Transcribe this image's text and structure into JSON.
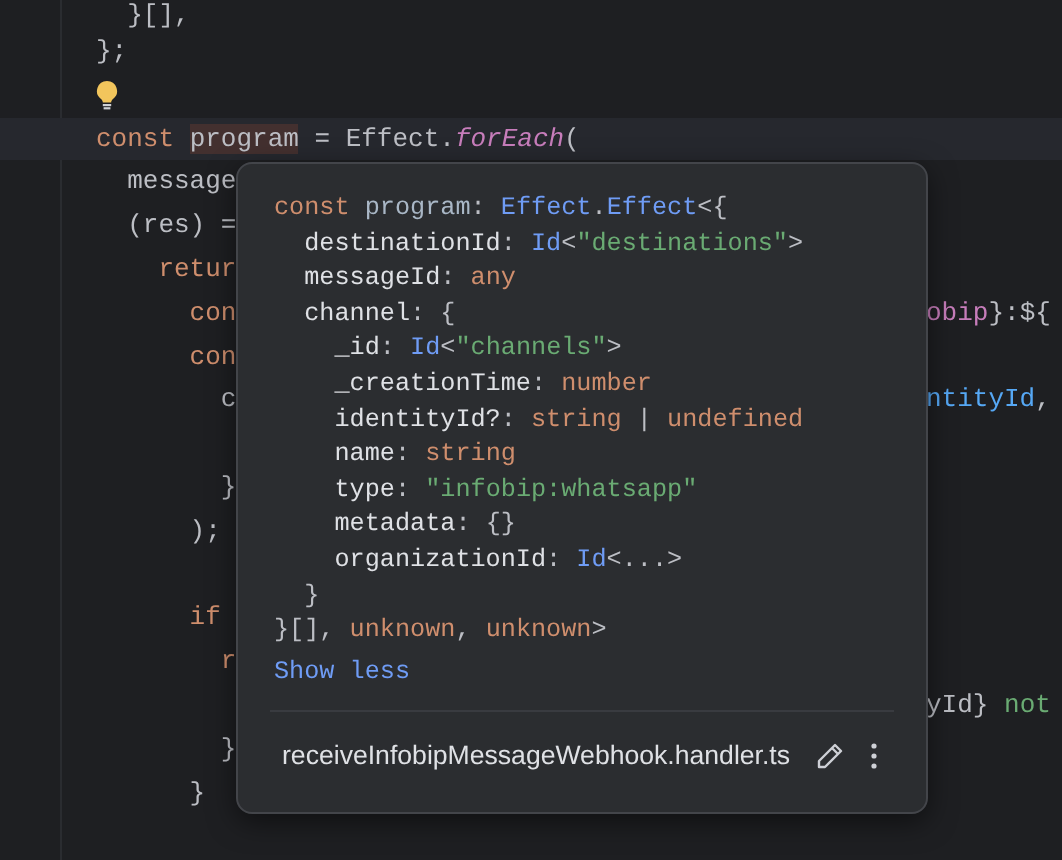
{
  "editor": {
    "lines": [
      {
        "kind": "code",
        "left": [
          {
            "text": "  }[],",
            "kind": "plain"
          }
        ]
      },
      {
        "kind": "code",
        "left": [
          {
            "text": "};",
            "kind": "plain"
          }
        ]
      },
      {
        "kind": "bulb"
      },
      {
        "kind": "code",
        "current": true,
        "left": [
          {
            "text": "const ",
            "kind": "keyword"
          },
          {
            "text": "program",
            "kind": "plain",
            "highlighted": true
          },
          {
            "text": " = Effect.",
            "kind": "plain"
          },
          {
            "text": "forEach",
            "kind": "fn"
          },
          {
            "text": "(",
            "kind": "plain"
          }
        ]
      },
      {
        "kind": "code",
        "left": [
          {
            "text": "  message",
            "kind": "plain"
          }
        ]
      },
      {
        "kind": "code",
        "left": [
          {
            "text": "  (res) =",
            "kind": "plain"
          }
        ]
      },
      {
        "kind": "code",
        "left": [
          {
            "text": "    retur",
            "kind": "keyword"
          }
        ]
      },
      {
        "kind": "code",
        "left": [
          {
            "text": "      con",
            "kind": "keyword"
          }
        ],
        "right": [
          {
            "text": "obip",
            "kind": "template"
          },
          {
            "text": "}:${",
            "kind": "plain"
          }
        ]
      },
      {
        "kind": "code",
        "left": [
          {
            "text": "      con",
            "kind": "keyword"
          }
        ]
      },
      {
        "kind": "code",
        "left": [
          {
            "text": "        c",
            "kind": "plain"
          }
        ],
        "right": [
          {
            "text": "ntityId",
            "kind": "ident"
          },
          {
            "text": ",",
            "kind": "plain"
          }
        ]
      },
      {
        "kind": "blank"
      },
      {
        "kind": "code",
        "left": [
          {
            "text": "        }",
            "kind": "plain"
          }
        ]
      },
      {
        "kind": "code",
        "left": [
          {
            "text": "      );",
            "kind": "plain"
          }
        ]
      },
      {
        "kind": "blank"
      },
      {
        "kind": "code",
        "left": [
          {
            "text": "      if",
            "kind": "keyword"
          }
        ]
      },
      {
        "kind": "code",
        "left": [
          {
            "text": "        r",
            "kind": "keyword"
          }
        ]
      },
      {
        "kind": "code",
        "right": [
          {
            "text": "yId}",
            "kind": "plain"
          },
          {
            "text": " not",
            "kind": "string"
          }
        ]
      },
      {
        "kind": "code",
        "left": [
          {
            "text": "        }",
            "kind": "plain"
          }
        ]
      },
      {
        "kind": "code",
        "left": [
          {
            "text": "      }",
            "kind": "plain"
          }
        ]
      }
    ]
  },
  "popup": {
    "signature": [
      [
        {
          "text": "const ",
          "kind": "keyword"
        },
        {
          "text": "program",
          "kind": "local"
        },
        {
          "text": ": ",
          "kind": "plain"
        },
        {
          "text": "Effect",
          "kind": "type"
        },
        {
          "text": ".",
          "kind": "plain"
        },
        {
          "text": "Effect",
          "kind": "type"
        },
        {
          "text": "<{",
          "kind": "plain"
        }
      ],
      [
        {
          "text": "  destinationId",
          "kind": "field"
        },
        {
          "text": ": ",
          "kind": "plain"
        },
        {
          "text": "Id",
          "kind": "type"
        },
        {
          "text": "<",
          "kind": "plain"
        },
        {
          "text": "\"destinations\"",
          "kind": "string"
        },
        {
          "text": ">",
          "kind": "plain"
        }
      ],
      [
        {
          "text": "  messageId",
          "kind": "field"
        },
        {
          "text": ": ",
          "kind": "plain"
        },
        {
          "text": "any",
          "kind": "keyword"
        }
      ],
      [
        {
          "text": "  channel",
          "kind": "field"
        },
        {
          "text": ": {",
          "kind": "plain"
        }
      ],
      [
        {
          "text": "    _id",
          "kind": "field"
        },
        {
          "text": ": ",
          "kind": "plain"
        },
        {
          "text": "Id",
          "kind": "type"
        },
        {
          "text": "<",
          "kind": "plain"
        },
        {
          "text": "\"channels\"",
          "kind": "string"
        },
        {
          "text": ">",
          "kind": "plain"
        }
      ],
      [
        {
          "text": "    _creationTime",
          "kind": "field"
        },
        {
          "text": ": ",
          "kind": "plain"
        },
        {
          "text": "number",
          "kind": "keyword"
        }
      ],
      [
        {
          "text": "    identityId?",
          "kind": "field"
        },
        {
          "text": ": ",
          "kind": "plain"
        },
        {
          "text": "string",
          "kind": "keyword"
        },
        {
          "text": " | ",
          "kind": "plain"
        },
        {
          "text": "undefined",
          "kind": "keyword"
        }
      ],
      [
        {
          "text": "    name",
          "kind": "field"
        },
        {
          "text": ": ",
          "kind": "plain"
        },
        {
          "text": "string",
          "kind": "keyword"
        }
      ],
      [
        {
          "text": "    type",
          "kind": "field"
        },
        {
          "text": ": ",
          "kind": "plain"
        },
        {
          "text": "\"infobip:whatsapp\"",
          "kind": "string"
        }
      ],
      [
        {
          "text": "    metadata",
          "kind": "field"
        },
        {
          "text": ": {}",
          "kind": "plain"
        }
      ],
      [
        {
          "text": "    organizationId",
          "kind": "field"
        },
        {
          "text": ": ",
          "kind": "plain"
        },
        {
          "text": "Id",
          "kind": "type"
        },
        {
          "text": "<...>",
          "kind": "plain"
        }
      ],
      [
        {
          "text": "  }",
          "kind": "plain"
        }
      ],
      [
        {
          "text": "}[], ",
          "kind": "plain"
        },
        {
          "text": "unknown",
          "kind": "keyword"
        },
        {
          "text": ", ",
          "kind": "plain"
        },
        {
          "text": "unknown",
          "kind": "keyword"
        },
        {
          "text": ">",
          "kind": "plain"
        }
      ]
    ],
    "toggle": "Show less",
    "file": "receiveInfobipMessageWebhook.handler.ts"
  }
}
